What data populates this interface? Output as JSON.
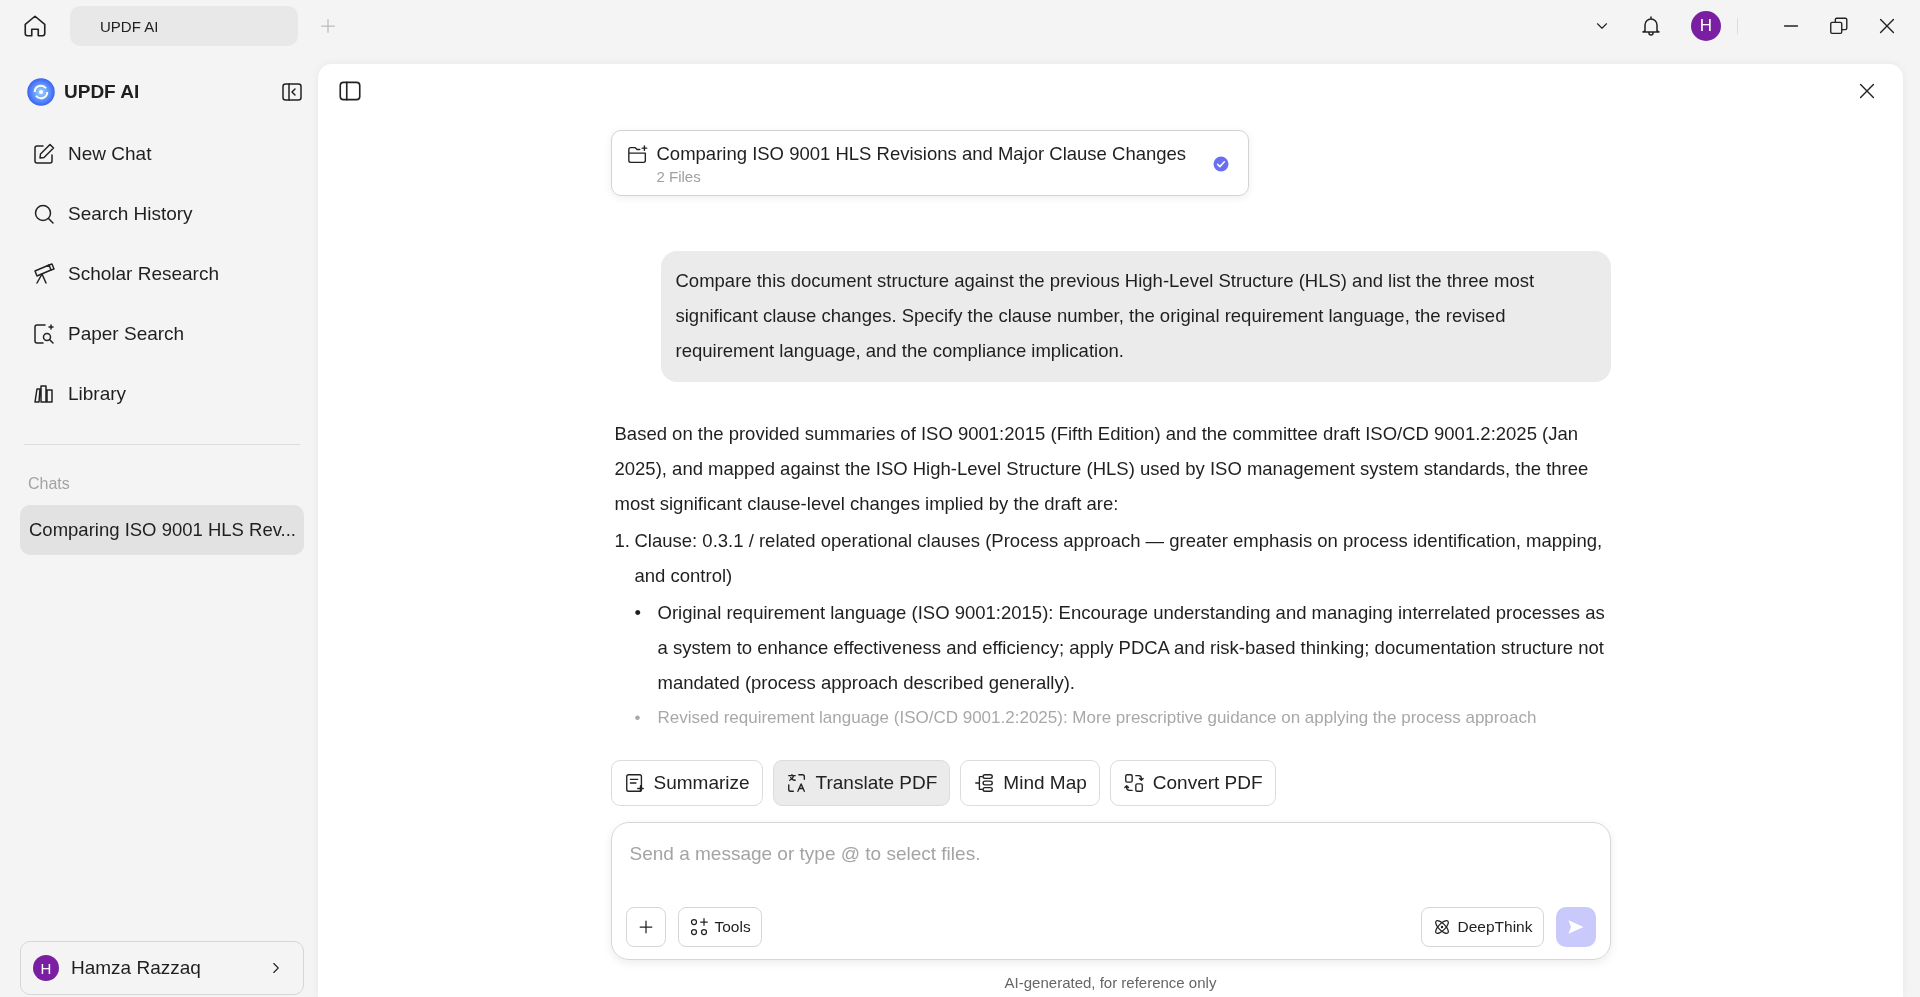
{
  "title_bar": {
    "tabs": [
      {
        "label": "UPDF AI",
        "selected": true
      }
    ],
    "avatar": "H"
  },
  "sidebar": {
    "title": "UPDF AI",
    "items": [
      {
        "label": "New Chat"
      },
      {
        "label": "Search History"
      },
      {
        "label": "Scholar Research"
      },
      {
        "label": "Paper Search"
      },
      {
        "label": "Library"
      }
    ],
    "section_label": "Chats",
    "chats": [
      {
        "label": "Comparing ISO 9001 HLS Rev...",
        "selected": true
      }
    ],
    "user": {
      "initial": "H",
      "name": "Hamza Razzaq"
    }
  },
  "chat": {
    "header": {
      "title": "Comparing ISO 9001 HLS Revisions and Major Clause Changes",
      "subtitle": "2 Files",
      "verified": true
    },
    "user_message": "Compare this document structure against the previous High-Level Structure (HLS) and list the three most significant clause changes. Specify the clause number, the original requirement language, the revised requirement language, and the compliance implication.",
    "response": [
      {
        "kind": "paragraph",
        "text": "Based on the provided summaries of ISO 9001:2015 (Fifth Edition) and the committee draft ISO/CD 9001.2:2025 (Jan 2025), and mapped against the ISO High-Level Structure (HLS) used by ISO management system standards, the three most significant clause-level changes implied by the draft are:"
      },
      {
        "kind": "numbered",
        "marker": "1.",
        "text": "Clause: 0.3.1 / related operational clauses (Process approach — greater emphasis on process identification, mapping, and control)"
      },
      {
        "kind": "bullet",
        "marker": "•",
        "text": "Original requirement language (ISO 9001:2015): Encourage understanding and managing interrelated processes as a system to enhance effectiveness and efficiency; apply PDCA and risk-based thinking; documentation structure not mandated (process approach described generally)."
      },
      {
        "kind": "bullet",
        "marker": "•",
        "faded": true,
        "text": "Revised requirement language (ISO/CD 9001.2:2025): More prescriptive guidance on applying the process approach"
      }
    ]
  },
  "actions": [
    {
      "label": "Summarize",
      "selected": false
    },
    {
      "label": "Translate PDF",
      "selected": true
    },
    {
      "label": "Mind Map",
      "selected": false
    },
    {
      "label": "Convert PDF",
      "selected": false
    }
  ],
  "composer": {
    "placeholder": "Send a message or type @ to select files.",
    "tools_label": "Tools",
    "deepthink_label": "DeepThink",
    "send_disabled": true
  },
  "footer_note": "AI-generated, for reference only"
}
